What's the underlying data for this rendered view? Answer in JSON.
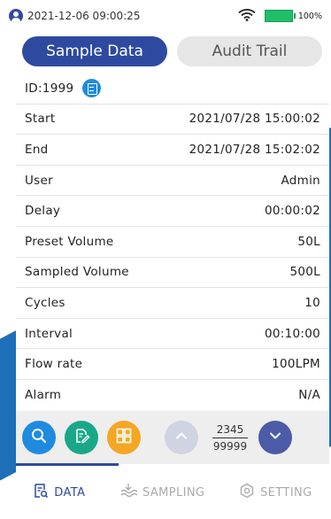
{
  "status_bar": {
    "datetime": "2021-12-06 09:00:25",
    "battery": "100%"
  },
  "tabs": [
    {
      "label": "Sample Data",
      "active": true
    },
    {
      "label": "Audit Trail",
      "active": false
    }
  ],
  "record": {
    "id": "ID:1999",
    "fields": [
      {
        "label": "Start",
        "value": "2021/07/28 15:00:02"
      },
      {
        "label": "End",
        "value": "2021/07/28 15:02:02"
      },
      {
        "label": "User",
        "value": "Admin"
      },
      {
        "label": "Delay",
        "value": "00:00:02"
      },
      {
        "label": "Preset Volume",
        "value": "50L"
      },
      {
        "label": "Sampled Volume",
        "value": "500L"
      },
      {
        "label": "Cycles",
        "value": "10"
      },
      {
        "label": "Interval",
        "value": "00:10:00"
      },
      {
        "label": "Flow rate",
        "value": "100LPM"
      },
      {
        "label": "Alarm",
        "value": "N/A"
      }
    ]
  },
  "pager": {
    "current": "2345",
    "total": "99999"
  },
  "bottom_nav": [
    {
      "label": "DATA",
      "icon": "data-icon",
      "active": true
    },
    {
      "label": "SAMPLING",
      "icon": "sampling-icon",
      "active": false
    },
    {
      "label": "SETTING",
      "icon": "setting-icon",
      "active": false
    }
  ],
  "colors": {
    "primary": "#2e4aa0",
    "search": "#1f8be0",
    "edit": "#18a889",
    "grid": "#f5a623",
    "battery": "#1fbf6a"
  }
}
